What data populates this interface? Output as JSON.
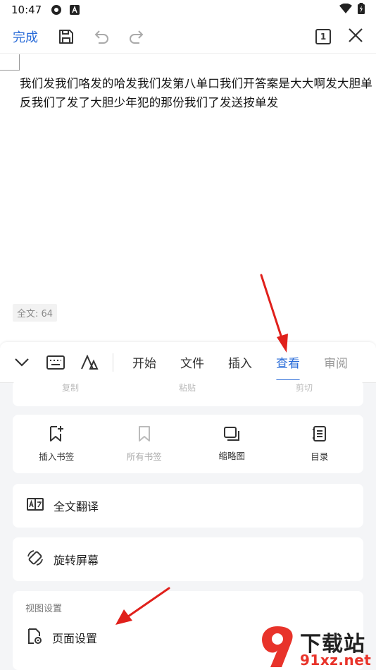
{
  "status_bar": {
    "time": "10:47"
  },
  "top_bar": {
    "done_label": "完成",
    "page_number": "1"
  },
  "document": {
    "text": "我们发我们咯发的哈发我们发第八单口我们开答案是大大啊发大胆单反我们了发了大胆少年犯的那份我们了发送按单发",
    "word_count": "全文: 64"
  },
  "tab_bar": {
    "tabs": [
      {
        "label": "开始"
      },
      {
        "label": "文件"
      },
      {
        "label": "插入"
      },
      {
        "label": "查看"
      },
      {
        "label": "审阅"
      }
    ],
    "active_tab": "查看"
  },
  "clipboard": {
    "copy": "复制",
    "paste": "粘贴",
    "cut": "剪切"
  },
  "tools": [
    {
      "label": "插入书签",
      "icon": "bookmark-add-icon",
      "enabled": true
    },
    {
      "label": "所有书签",
      "icon": "bookmark-icon",
      "enabled": false
    },
    {
      "label": "缩略图",
      "icon": "thumbnail-icon",
      "enabled": true
    },
    {
      "label": "目录",
      "icon": "toc-icon",
      "enabled": true
    }
  ],
  "rows": {
    "translate": "全文翻译",
    "rotate": "旋转屏幕"
  },
  "view_settings": {
    "title": "视图设置",
    "page_setup": "页面设置"
  },
  "colors": {
    "accent": "#2a6cd8",
    "annotation_arrow": "#e0201b"
  },
  "watermark": {
    "title": "下载站",
    "url": "91xz.net"
  }
}
